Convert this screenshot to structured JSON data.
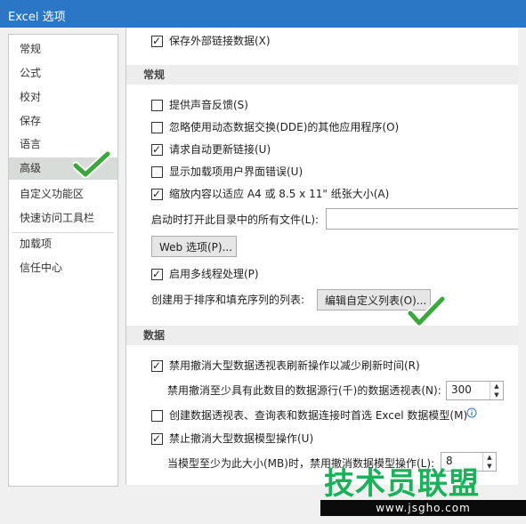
{
  "window": {
    "title": "Excel 选项"
  },
  "sidebar": {
    "items": [
      {
        "label": "常规"
      },
      {
        "label": "公式"
      },
      {
        "label": "校对"
      },
      {
        "label": "保存"
      },
      {
        "label": "语言"
      },
      {
        "label": "高级",
        "selected": true
      },
      {
        "label": "自定义功能区"
      },
      {
        "label": "快速访问工具栏"
      },
      {
        "label": "加载项"
      },
      {
        "label": "信任中心"
      }
    ]
  },
  "main": {
    "top_option": {
      "label": "保存外部链接数据(X)",
      "checked": true
    },
    "general": {
      "header": "常规",
      "options": [
        {
          "label": "提供声音反馈(S)",
          "checked": false
        },
        {
          "label": "忽略使用动态数据交换(DDE)的其他应用程序(O)",
          "checked": false
        },
        {
          "label": "请求自动更新链接(U)",
          "checked": true
        },
        {
          "label": "显示加载项用户界面错误(U)",
          "checked": false
        },
        {
          "label": "缩放内容以适应 A4 或 8.5 x 11\" 纸张大小(A)",
          "checked": true
        }
      ],
      "startup_label": "启动时打开此目录中的所有文件(L):",
      "startup_value": "",
      "web_options_button": "Web 选项(P)...",
      "multithread": {
        "label": "启用多线程处理(P)",
        "checked": true
      },
      "custom_list_label": "创建用于排序和填充序列的列表:",
      "custom_list_button": "编辑自定义列表(O)..."
    },
    "data": {
      "header": "数据",
      "disable_undo_pivot": {
        "label": "禁用撤消大型数据透视表刷新操作以减少刷新时间(R)",
        "checked": true
      },
      "pivot_rows_label": "禁用撤消至少具有此数目的数据源行(千)的数据透视表(N):",
      "pivot_rows_value": "300",
      "create_model": {
        "label": "创建数据透视表、查询表和数据连接时首选 Excel 数据模型(M)",
        "checked": false
      },
      "info_icon": "info-icon",
      "disable_undo_model": {
        "label": "禁止撤消大型数据模型操作(U)",
        "checked": true
      },
      "model_size_label": "当模型至少为此大小(MB)时，禁用撤消数据模型操作(L):",
      "model_size_value": "8"
    }
  },
  "watermark": {
    "logo": "技术员联盟",
    "url": "www.jsgho.com"
  },
  "colors": {
    "titlebar": "#2b77c5",
    "check": "#3aa83a",
    "selected": "#d7dcd8"
  }
}
